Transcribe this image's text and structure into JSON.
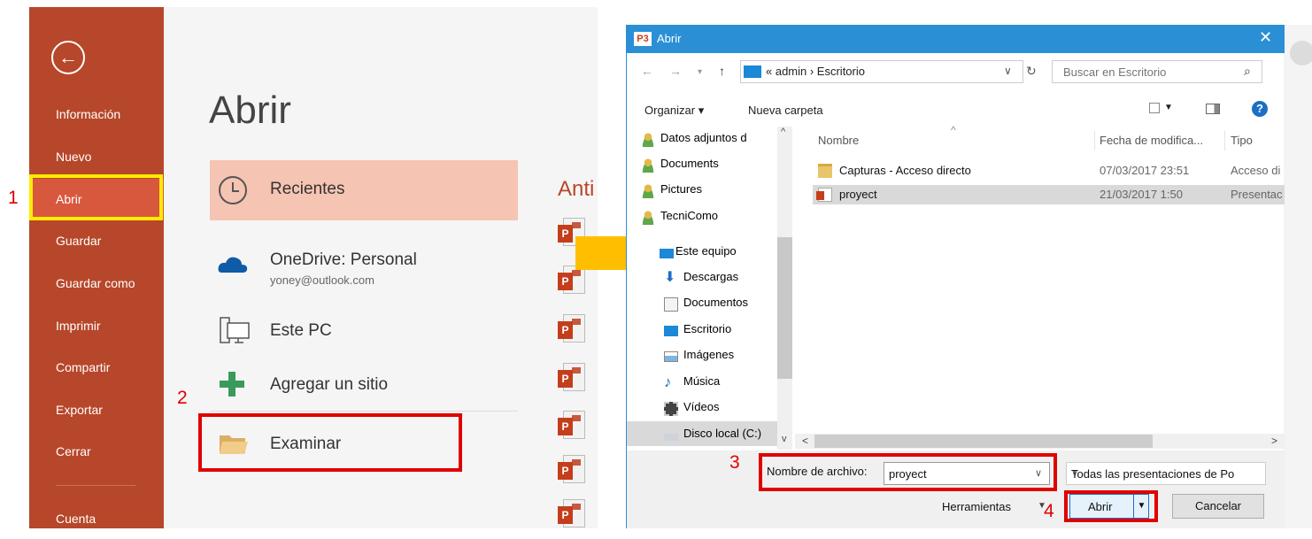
{
  "backstage": {
    "nav": [
      "Información",
      "Nuevo",
      "Abrir",
      "Guardar",
      "Guardar como",
      "Imprimir",
      "Compartir",
      "Exportar",
      "Cerrar",
      "Cuenta"
    ],
    "title": "Abrir",
    "places": {
      "recent": "Recientes",
      "onedrive": "OneDrive: Personal",
      "onedrive_email": "yoney@outlook.com",
      "pc": "Este PC",
      "add": "Agregar un sitio",
      "browse": "Examinar"
    },
    "recent_heading": "Anti"
  },
  "annotations": [
    "1",
    "2",
    "3",
    "4"
  ],
  "dialog": {
    "title": "Abrir",
    "address": "« admin › Escritorio",
    "search_placeholder": "Buscar en Escritorio",
    "toolbar": {
      "organize": "Organizar ▾",
      "new_folder": "Nueva carpeta"
    },
    "nav_items": [
      "Datos adjuntos d",
      "Documents",
      "Pictures",
      "TecniComo",
      "Este equipo",
      "Descargas",
      "Documentos",
      "Escritorio",
      "Imágenes",
      "Música",
      "Vídeos",
      "Disco local (C:)"
    ],
    "columns": {
      "name": "Nombre",
      "date": "Fecha de modifica...",
      "type": "Tipo"
    },
    "files": [
      {
        "name": "Capturas - Acceso directo",
        "date": "07/03/2017 23:51",
        "type": "Acceso di"
      },
      {
        "name": "proyect",
        "date": "21/03/2017 1:50",
        "type": "Presentac"
      }
    ],
    "filename_label": "Nombre de archivo:",
    "filename_value": "proyect",
    "filetype": "Todas las presentaciones de Po",
    "tools": "Herramientas",
    "open": "Abrir",
    "cancel": "Cancelar"
  },
  "colors": {
    "backstage": "#b7472a",
    "titlebar": "#2b8fd6",
    "annotation_red": "#e00000",
    "annotation_yellow": "#ffeb00",
    "arrow": "#ffbf00"
  }
}
